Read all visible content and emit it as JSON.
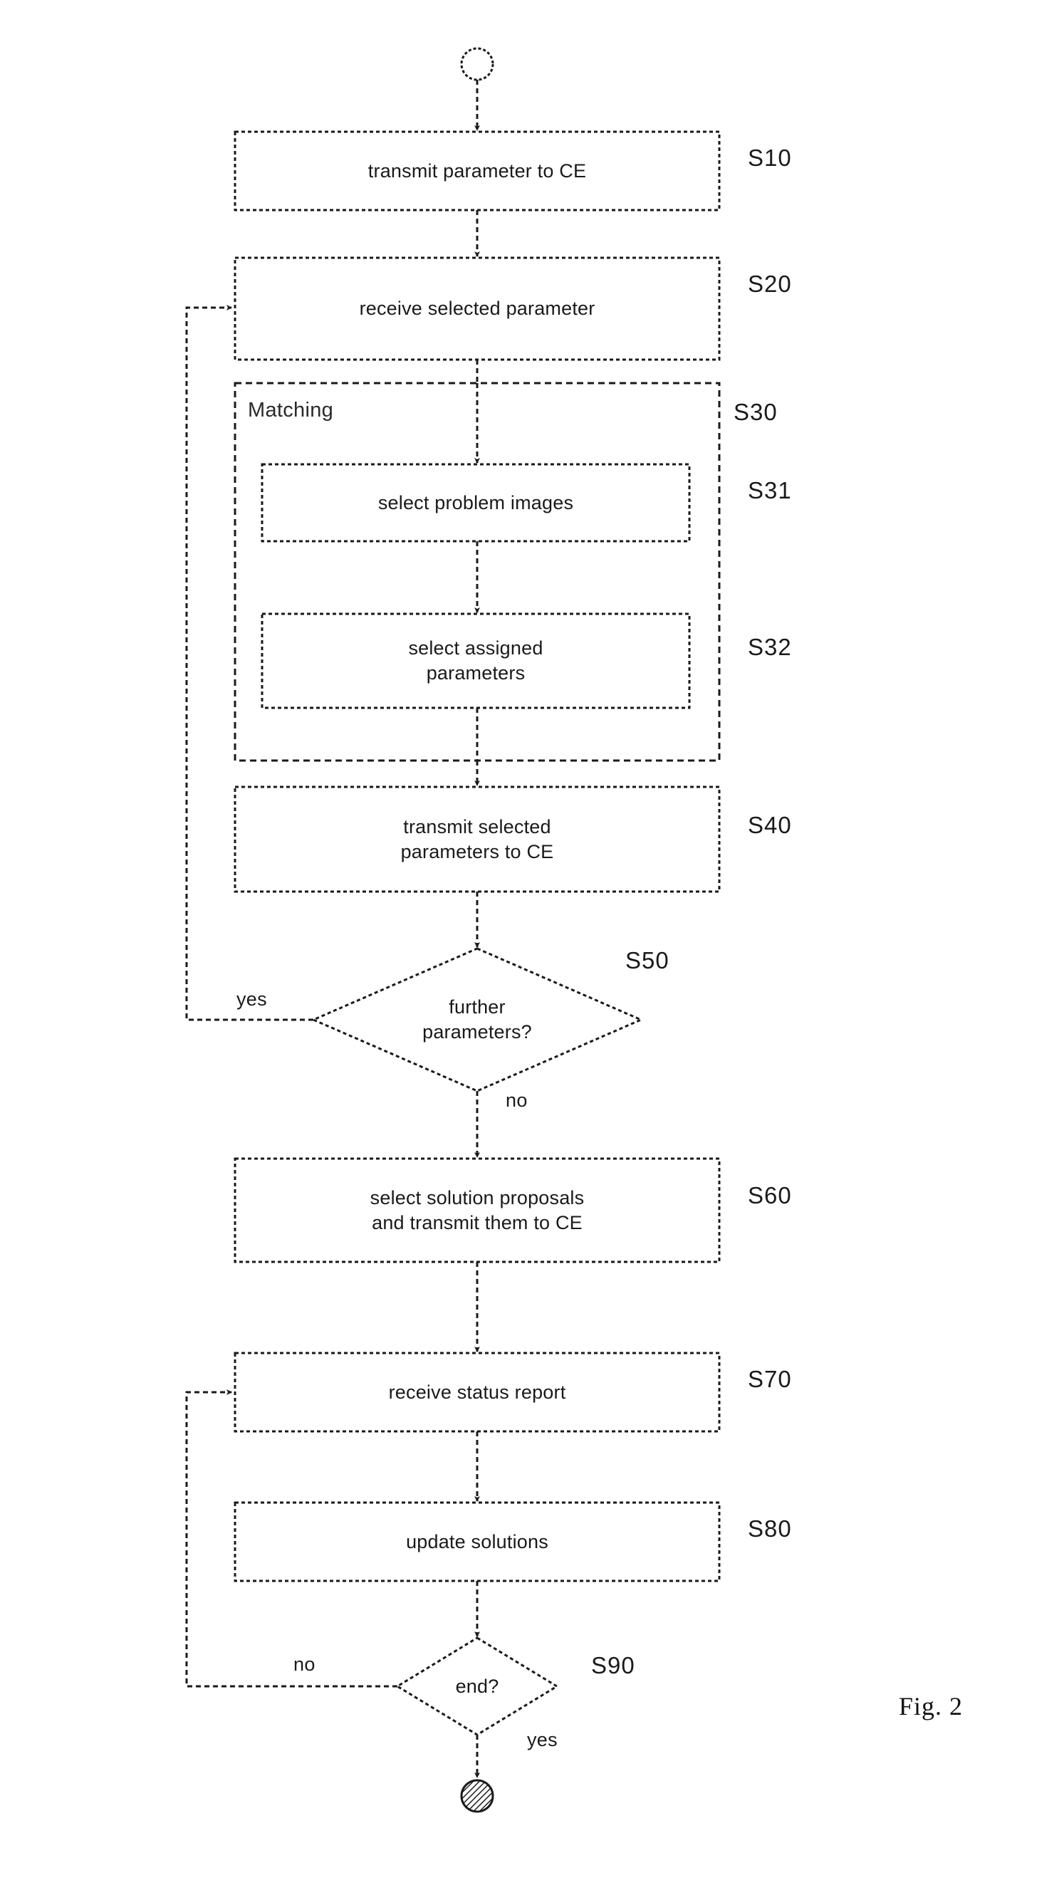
{
  "figure": {
    "caption": "Fig. 2",
    "group_title": "Matching"
  },
  "nodes": {
    "start": {
      "name": "start-node",
      "shape": "circle-open"
    },
    "end": {
      "name": "end-node",
      "shape": "circle-filled"
    },
    "s10": {
      "label": "transmit parameter to CE",
      "tag": "S10"
    },
    "s20": {
      "label": "receive selected parameter",
      "tag": "S20"
    },
    "s30": {
      "label": "Matching",
      "tag": "S30"
    },
    "s31": {
      "label": "select problem images",
      "tag": "S31"
    },
    "s32": {
      "label": "select assigned\nparameters",
      "tag": "S32"
    },
    "s40": {
      "label": "transmit selected\nparameters to CE",
      "tag": "S40"
    },
    "s50": {
      "label": "further\nparameters?",
      "tag": "S50"
    },
    "s60": {
      "label": "select solution proposals\nand transmit them to CE",
      "tag": "S60"
    },
    "s70": {
      "label": "receive status report",
      "tag": "S70"
    },
    "s80": {
      "label": "update solutions",
      "tag": "S80"
    },
    "s90": {
      "label": "end?",
      "tag": "S90"
    }
  },
  "edge_labels": {
    "s50_yes": "yes",
    "s50_no": "no",
    "s90_no": "no",
    "s90_yes": "yes"
  },
  "colors": {
    "stroke": "#1a1a1a",
    "background": "#ffffff",
    "text": "#1a1a1a"
  }
}
